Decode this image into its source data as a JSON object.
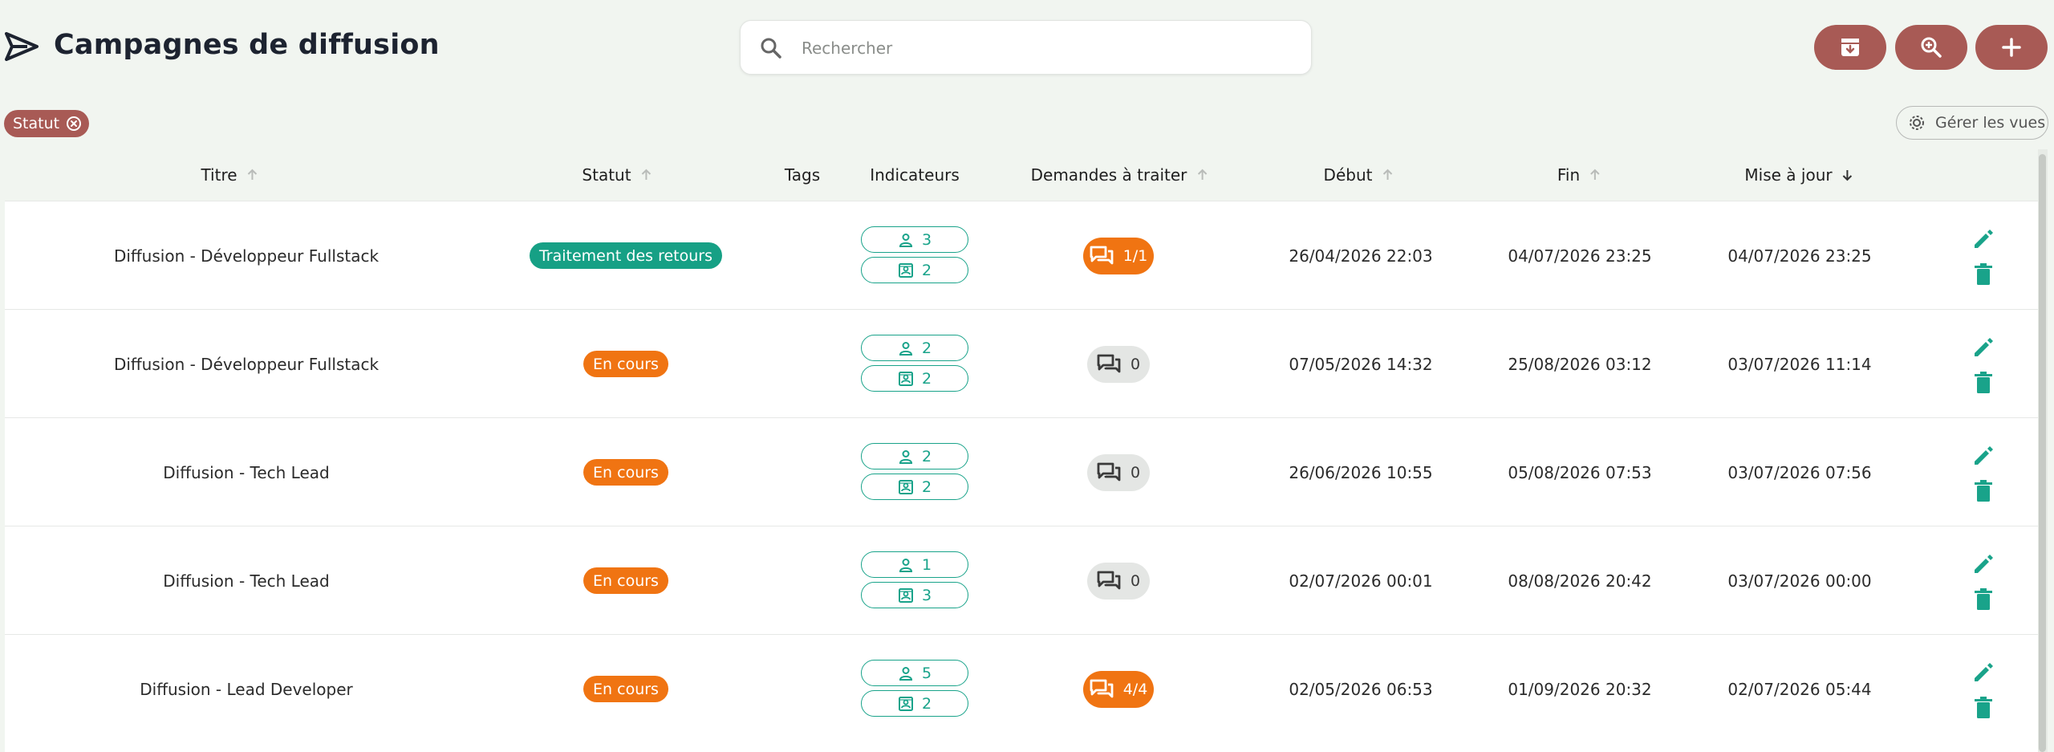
{
  "header": {
    "title": "Campagnes de diffusion",
    "search_placeholder": "Rechercher"
  },
  "toolbar": [
    {
      "name": "archive-button",
      "icon": "archive-icon"
    },
    {
      "name": "zoom-search-button",
      "icon": "zoom-in-icon"
    },
    {
      "name": "add-button",
      "icon": "plus-icon"
    }
  ],
  "filters": {
    "chip_label": "Statut",
    "views_label": "Gérer les vues"
  },
  "table": {
    "columns": [
      {
        "label": "Titre",
        "sort": "asc-inactive"
      },
      {
        "label": "Statut",
        "sort": "asc-inactive"
      },
      {
        "label": "Tags",
        "sort": "none"
      },
      {
        "label": "Indicateurs",
        "sort": "none"
      },
      {
        "label": "Demandes à traiter",
        "sort": "asc-inactive"
      },
      {
        "label": "Début",
        "sort": "asc-inactive"
      },
      {
        "label": "Fin",
        "sort": "asc-inactive"
      },
      {
        "label": "Mise à jour",
        "sort": "desc-active"
      }
    ],
    "rows": [
      {
        "title": "Diffusion - Développeur Fullstack",
        "status": "Traitement des retours",
        "status_color": "#16a085",
        "candidates": "3",
        "profiles": "2",
        "requests": "1/1",
        "requests_active": true,
        "start": "26/04/2026 22:03",
        "end": "04/07/2026 23:25",
        "updated": "04/07/2026 23:25"
      },
      {
        "title": "Diffusion - Développeur Fullstack",
        "status": "En cours",
        "status_color": "#f07412",
        "candidates": "2",
        "profiles": "2",
        "requests": "0",
        "requests_active": false,
        "start": "07/05/2026 14:32",
        "end": "25/08/2026 03:12",
        "updated": "03/07/2026 11:14"
      },
      {
        "title": "Diffusion - Tech Lead",
        "status": "En cours",
        "status_color": "#f07412",
        "candidates": "2",
        "profiles": "2",
        "requests": "0",
        "requests_active": false,
        "start": "26/06/2026 10:55",
        "end": "05/08/2026 07:53",
        "updated": "03/07/2026 07:56"
      },
      {
        "title": "Diffusion - Tech Lead",
        "status": "En cours",
        "status_color": "#f07412",
        "candidates": "1",
        "profiles": "3",
        "requests": "0",
        "requests_active": false,
        "start": "02/07/2026 00:01",
        "end": "08/08/2026 20:42",
        "updated": "03/07/2026 00:00"
      },
      {
        "title": "Diffusion - Lead Developer",
        "status": "En cours",
        "status_color": "#f07412",
        "candidates": "5",
        "profiles": "2",
        "requests": "4/4",
        "requests_active": true,
        "start": "02/05/2026 06:53",
        "end": "01/09/2026 20:32",
        "updated": "02/07/2026 05:44"
      }
    ]
  },
  "colors": {
    "accent": "#a85a55",
    "teal": "#19a38a",
    "orange": "#f07412",
    "background": "#f1f5f0"
  }
}
